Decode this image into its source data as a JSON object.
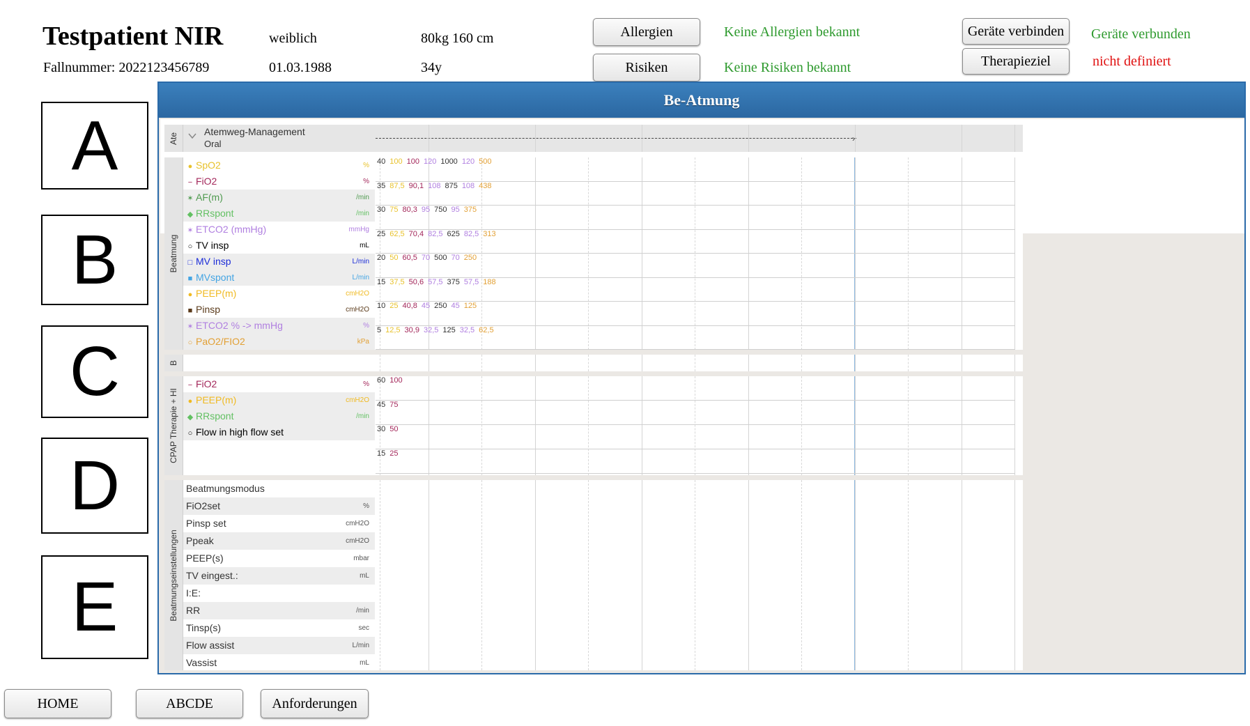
{
  "header": {
    "patient_name": "Testpatient NIR",
    "case_number": "Fallnummer: 2022123456789",
    "gender": "weiblich",
    "birthdate": "01.03.1988",
    "weight_height": "80kg  160 cm",
    "age": "34y",
    "allergies_button": "Allergien",
    "allergies_status": "Keine Allergien bekannt",
    "risks_button": "Risiken",
    "risks_status": "Keine Risiken bekannt",
    "devices_button": "Geräte verbinden",
    "devices_status": "Geräte verbunden",
    "therapy_button": "Therapieziel",
    "therapy_status": "nicht definiert"
  },
  "colors": {
    "status_green": "#2e9a2e",
    "status_red": "#e01010",
    "panel_blue": "#2b67a1"
  },
  "abcde": [
    "A",
    "B",
    "C",
    "D",
    "E"
  ],
  "panel": {
    "title": "Be-Atmung",
    "airway": {
      "side_label": "Ate",
      "title": "Atemweg-Management",
      "subtitle": "Oral"
    },
    "beatmung": {
      "side_label": "Beatmung",
      "params": [
        {
          "symbol": "●",
          "label": "SpO2",
          "unit": "%",
          "color": "#e8c22c"
        },
        {
          "symbol": "−",
          "label": "FiO2",
          "unit": "%",
          "color": "#a3275a"
        },
        {
          "symbol": "✶",
          "label": "AF(m)",
          "unit": "/min",
          "color": "#4f9a4f"
        },
        {
          "symbol": "◆",
          "label": "RRspont",
          "unit": "/min",
          "color": "#62c062"
        },
        {
          "symbol": "✶",
          "label": "ETCO2 (mmHg)",
          "unit": "mmHg",
          "color": "#b07fe0"
        },
        {
          "symbol": "○",
          "label": "TV insp",
          "unit": "mL",
          "color": "#000000"
        },
        {
          "symbol": "□",
          "label": "MV insp",
          "unit": "L/min",
          "color": "#1a2bd8"
        },
        {
          "symbol": "■",
          "label": "MVspont",
          "unit": "L/min",
          "color": "#43a4e3"
        },
        {
          "symbol": "●",
          "label": "PEEP(m)",
          "unit": "cmH2O",
          "color": "#f0ba22"
        },
        {
          "symbol": "■",
          "label": "Pinsp",
          "unit": "cmH2O",
          "color": "#5a3a1a"
        },
        {
          "symbol": "✶",
          "label": "ETCO2 % -> mmHg",
          "unit": "%",
          "color": "#b07fe0"
        },
        {
          "symbol": "○",
          "label": "PaO2/FIO2",
          "unit": "kPa",
          "color": "#e2a035"
        }
      ],
      "scale_rows": [
        [
          "40",
          "100",
          "100",
          "120",
          "1000",
          "120",
          "500"
        ],
        [
          "35",
          "87,5",
          "90,1",
          "108",
          "875",
          "108",
          "438"
        ],
        [
          "30",
          "75",
          "80,3",
          "95",
          "750",
          "95",
          "375"
        ],
        [
          "25",
          "62,5",
          "70,4",
          "82,5",
          "625",
          "82,5",
          "313"
        ],
        [
          "20",
          "50",
          "60,5",
          "70",
          "500",
          "70",
          "250"
        ],
        [
          "15",
          "37,5",
          "50,6",
          "57,5",
          "375",
          "57,5",
          "188"
        ],
        [
          "10",
          "25",
          "40,8",
          "45",
          "250",
          "45",
          "125"
        ],
        [
          "5",
          "12,5",
          "30,9",
          "32,5",
          "125",
          "32,5",
          "62,5"
        ]
      ],
      "scale_colors": [
        "#333333",
        "#e8c22c",
        "#a3275a",
        "#b07fe0",
        "#333333",
        "#b07fe0",
        "#e2a035"
      ]
    },
    "b_section": {
      "side_label": "B"
    },
    "cpap": {
      "side_label": "CPAP Therapie + HI",
      "params": [
        {
          "symbol": "−",
          "label": "FiO2",
          "unit": "%",
          "color": "#a3275a"
        },
        {
          "symbol": "●",
          "label": "PEEP(m)",
          "unit": "cmH2O",
          "color": "#f0ba22"
        },
        {
          "symbol": "◆",
          "label": "RRspont",
          "unit": "/min",
          "color": "#62c062"
        },
        {
          "symbol": "○",
          "label": "Flow in high flow set",
          "unit": "",
          "color": "#000000"
        }
      ],
      "scale_rows": [
        [
          "60",
          "100"
        ],
        [
          "45",
          "75"
        ],
        [
          "30",
          "50"
        ],
        [
          "15",
          "25"
        ]
      ],
      "scale_colors": [
        "#333333",
        "#a3275a"
      ]
    },
    "settings": {
      "side_label": "Beatmungseinstellungen",
      "rows": [
        {
          "label": "Beatmungsmodus",
          "unit": ""
        },
        {
          "label": "FiO2set",
          "unit": "%"
        },
        {
          "label": "Pinsp set",
          "unit": "cmH2O"
        },
        {
          "label": "Ppeak",
          "unit": "cmH2O"
        },
        {
          "label": "PEEP(s)",
          "unit": "mbar"
        },
        {
          "label": "TV eingest.:",
          "unit": "mL"
        },
        {
          "label": "I:E:",
          "unit": ""
        },
        {
          "label": "RR",
          "unit": "/min"
        },
        {
          "label": "Tinsp(s)",
          "unit": "sec"
        },
        {
          "label": "Flow assist",
          "unit": "L/min"
        },
        {
          "label": "Vassist",
          "unit": "mL"
        }
      ]
    }
  },
  "footer": {
    "home": "HOME",
    "abcde": "ABCDE",
    "requests": "Anforderungen"
  }
}
